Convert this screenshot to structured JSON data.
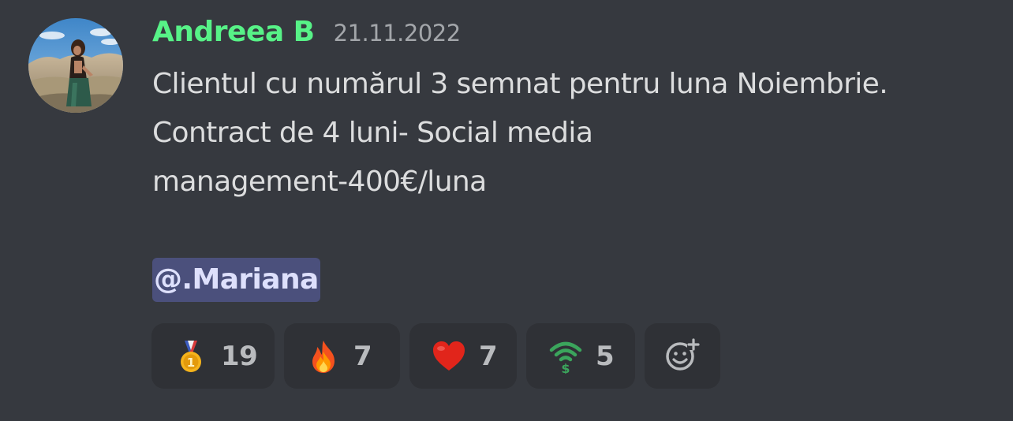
{
  "message": {
    "author": "Andreea B",
    "timestamp": "21.11.2022",
    "lines": [
      "Clientul cu numărul 3 semnat pentru luna Noiembrie.",
      "Contract de 4 luni- Social media",
      "management-400€/luna"
    ],
    "mention": "@.Mariana"
  },
  "reactions": [
    {
      "emoji": "medal-icon",
      "count": "19"
    },
    {
      "emoji": "fire-icon",
      "count": "7"
    },
    {
      "emoji": "heart-icon",
      "count": "7"
    },
    {
      "emoji": "wifi-dollar-icon",
      "count": "5"
    }
  ],
  "colors": {
    "background": "#36393f",
    "username": "#57f287",
    "text": "#dcddde",
    "timestamp": "#a3a6aa",
    "mention_bg": "#4b507c",
    "mention_text": "#dee0fc",
    "reaction_bg": "#2f3136"
  }
}
